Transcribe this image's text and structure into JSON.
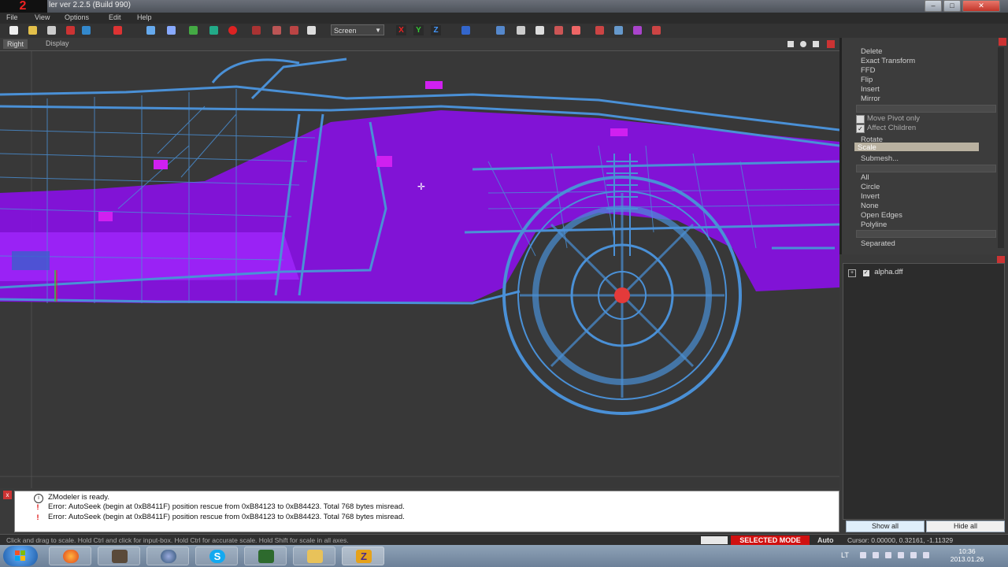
{
  "window": {
    "badge": "2",
    "title": "ler ver 2.2.5 (Build 990)",
    "buttons": [
      "–",
      "□",
      "✕"
    ]
  },
  "menu": [
    "File",
    "View",
    "Options",
    "Edit",
    "Help"
  ],
  "toolbar": {
    "view_select": "Screen",
    "axis_x": "X",
    "axis_y": "Y",
    "axis_z": "Z"
  },
  "viewport": {
    "tab_label": "Right",
    "display_label": "Display"
  },
  "right_panel": {
    "modify_items": [
      "Delete",
      "Exact Transform",
      "FFD",
      "Flip",
      "Insert",
      "Mirror"
    ],
    "checkbox_move_pivot": "Move Pivot only",
    "checkbox_affect_children": "Affect Children",
    "transform_items": [
      "Rotate",
      "Scale",
      "Submesh..."
    ],
    "selected_item": "Scale",
    "select_items": [
      "All",
      "Circle",
      "Invert",
      "None",
      "Open Edges",
      "Polyline"
    ],
    "separated": "Separated"
  },
  "scene_tree": {
    "item": "alpha.dff",
    "show_all": "Show all",
    "hide_all": "Hide all"
  },
  "log": [
    {
      "type": "info",
      "text": "ZModeler is ready."
    },
    {
      "type": "error",
      "text": "Error: AutoSeek (begin at 0xB8411F) position rescue  from 0xB84123 to 0xB84423. Total 768 bytes misread."
    },
    {
      "type": "error",
      "text": "Error: AutoSeek (begin at 0xB8411F) position rescue  from 0xB84123 to 0xB84423. Total 768 bytes misread."
    }
  ],
  "status": {
    "hint": "Click and drag to scale. Hold Ctrl and click for input-box. Hold Ctrl for accurate scale. Hold Shift for scale in all axes.",
    "mode": "SELECTED MODE",
    "auto": "Auto",
    "cursor": "Cursor: 0.00000, 0.32161, -1.11329"
  },
  "taskbar": {
    "language": "LT",
    "time": "10:36",
    "date": "2013.01.26",
    "apps": [
      "firefox-icon",
      "game-icon",
      "network-icon",
      "skype-icon",
      "monitor-icon",
      "folder-icon",
      "zmodeler-icon"
    ]
  },
  "colors": {
    "wire": "#4a90d6",
    "mesh": "#8a10e8",
    "selected_mode": "#d01010"
  }
}
